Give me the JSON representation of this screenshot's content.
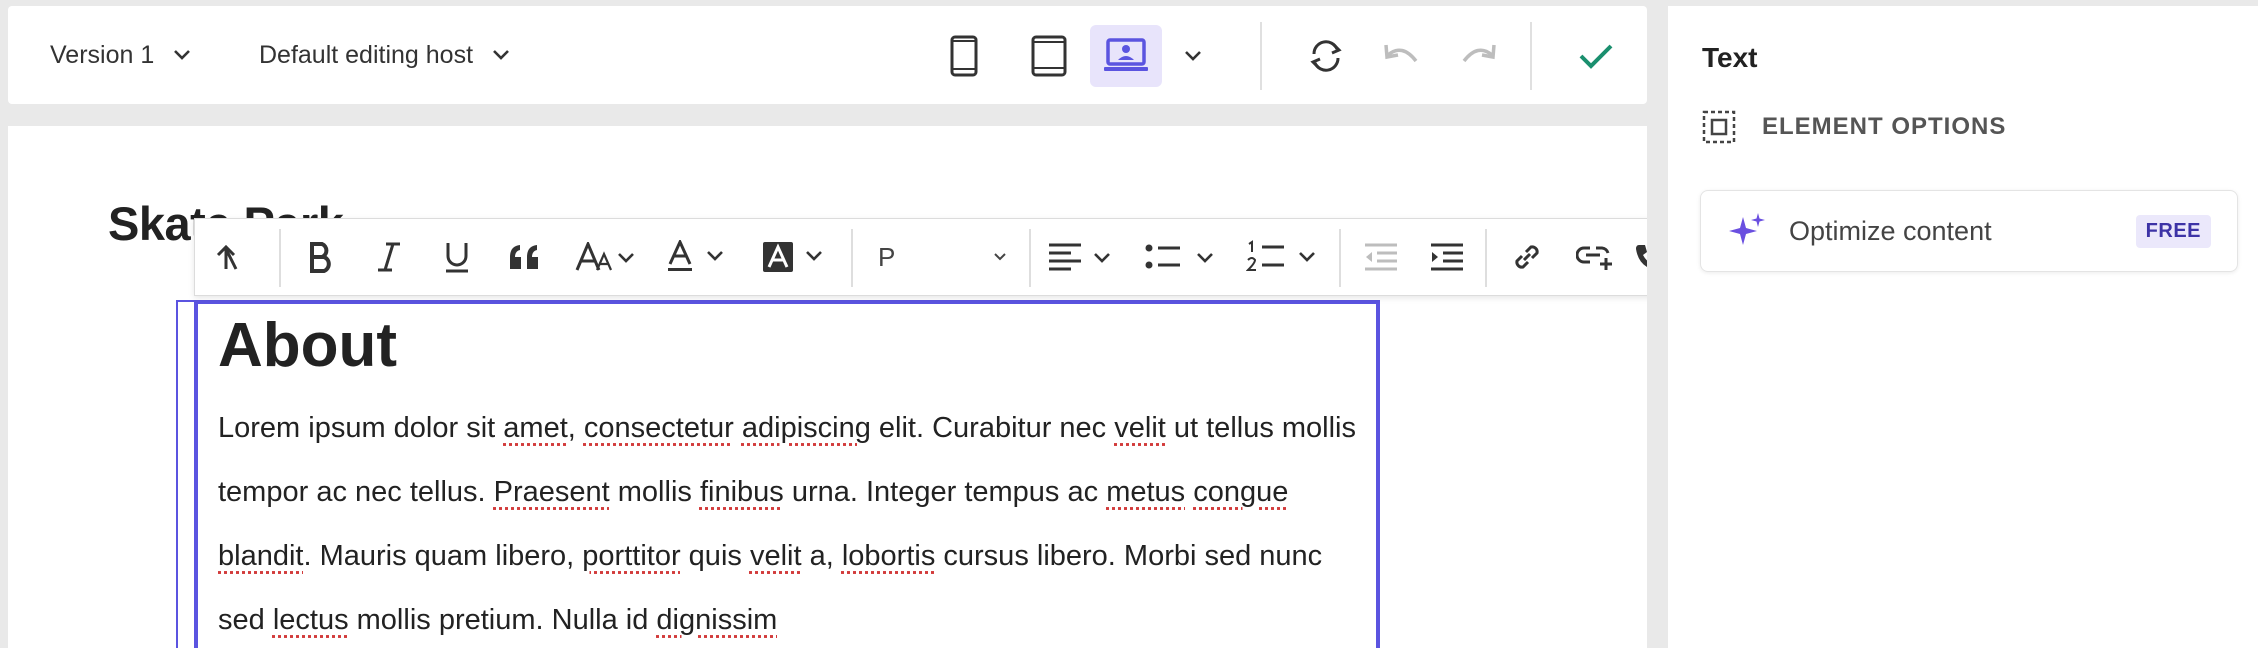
{
  "toolbar": {
    "version_label": "Version 1",
    "host_label": "Default editing host",
    "devices": [
      "mobile",
      "tablet",
      "desktop"
    ],
    "active_device": "desktop",
    "accent": "#5b54e0",
    "confirm_color": "#1a8f6e"
  },
  "canvas": {
    "page_heading": "Skate Park",
    "editor": {
      "block_format": "P",
      "heading": "About",
      "paragraph": {
        "segments": [
          {
            "t": "Lorem ipsum dolor sit "
          },
          {
            "t": "amet",
            "sp": true
          },
          {
            "t": ", "
          },
          {
            "t": "consectetur",
            "sp": true
          },
          {
            "t": " "
          },
          {
            "t": "adipiscing",
            "sp": true
          },
          {
            "t": " elit. Curabitur nec "
          },
          {
            "t": "velit",
            "sp": true
          },
          {
            "t": " ut tellus mollis tempor ac nec tellus. "
          },
          {
            "t": "Praesent",
            "sp": true
          },
          {
            "t": " mollis "
          },
          {
            "t": "finibus",
            "sp": true
          },
          {
            "t": " urna. Integer tempus ac "
          },
          {
            "t": "metus",
            "sp": true
          },
          {
            "t": " "
          },
          {
            "t": "congue",
            "sp": true
          },
          {
            "t": " "
          },
          {
            "t": "blandit",
            "sp": true
          },
          {
            "t": ". Mauris quam libero, "
          },
          {
            "t": "porttitor",
            "sp": true
          },
          {
            "t": " quis "
          },
          {
            "t": "velit",
            "sp": true
          },
          {
            "t": " a, "
          },
          {
            "t": "lobortis",
            "sp": true
          },
          {
            "t": " cursus libero. Morbi sed nunc sed "
          },
          {
            "t": "lectus",
            "sp": true
          },
          {
            "t": " mollis pretium. Nulla id "
          },
          {
            "t": "dignissim",
            "sp": true
          }
        ]
      }
    }
  },
  "panel": {
    "title": "Text",
    "section_label": "ELEMENT OPTIONS",
    "optimize_label": "Optimize content",
    "optimize_badge": "FREE"
  }
}
